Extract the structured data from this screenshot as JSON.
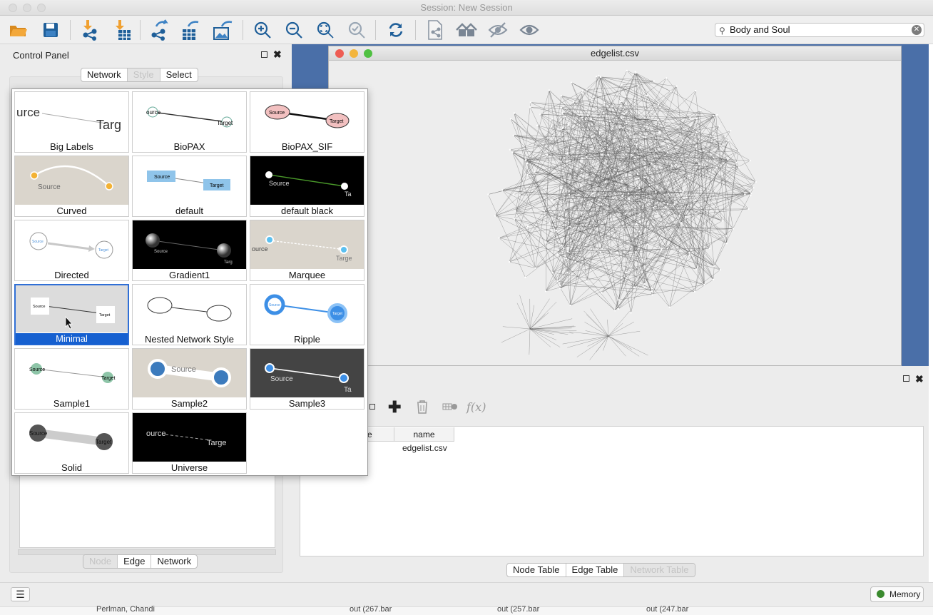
{
  "window": {
    "title": "Session: New Session"
  },
  "toolbar": {
    "icons": [
      "open-folder-icon",
      "save-icon",
      "import-network-icon",
      "import-table-icon",
      "share-network-icon",
      "export-table-icon",
      "export-image-icon",
      "zoom-in-icon",
      "zoom-out-icon",
      "zoom-fit-icon",
      "zoom-selected-icon",
      "refresh-icon",
      "new-network-icon",
      "home-icon",
      "hide-icon",
      "show-icon"
    ],
    "search_value": "Body and Soul"
  },
  "control_panel": {
    "title": "Control Panel",
    "tabs": [
      "Network",
      "Style",
      "Select"
    ],
    "bottom_tabs": [
      "Node",
      "Edge",
      "Network"
    ]
  },
  "style_popup": {
    "styles": [
      "Big Labels",
      "BioPAX",
      "BioPAX_SIF",
      "Curved",
      "default",
      "default black",
      "Directed",
      "Gradient1",
      "Marquee",
      "Minimal",
      "Nested Network Style",
      "Ripple",
      "Sample1",
      "Sample2",
      "Sample3",
      "Solid",
      "Universe"
    ],
    "selected": "Minimal",
    "thumb_text": {
      "big_labels": [
        "urce",
        "Targ"
      ],
      "biopax": [
        "ource",
        "Target"
      ],
      "biopax_sif": [
        "Source",
        "Target"
      ],
      "curved": [
        "Source"
      ],
      "default": [
        "Source",
        "Target"
      ],
      "default_black": [
        "Source",
        "Ta"
      ],
      "directed": [
        "Source",
        "Target"
      ],
      "gradient1": [
        "Source",
        "Targ"
      ],
      "marquee": [
        "ource",
        "Targe"
      ],
      "minimal": [
        "Source",
        "Target"
      ],
      "ripple": [
        "Source",
        "Target"
      ],
      "sample1": [
        "Source",
        "Target"
      ],
      "sample2": [
        "Source"
      ],
      "sample3": [
        "Source",
        "Ta"
      ],
      "solid": [
        "Source",
        "Target"
      ],
      "universe": [
        "ource",
        "Targe"
      ]
    }
  },
  "network_view": {
    "title": "edgelist.csv"
  },
  "table_panel": {
    "columns": [
      "e",
      "name"
    ],
    "rows": [
      [
        "",
        "edgelist.csv"
      ]
    ],
    "tabs": [
      "Node Table",
      "Edge Table",
      "Network Table"
    ]
  },
  "status": {
    "memory_label": "Memory",
    "memory_color": "#3a8a2e"
  },
  "bottom_strip": {
    "items": [
      "Perlman, Chandi",
      "out (267.bar",
      "out (257.bar",
      "out (247.bar"
    ]
  }
}
